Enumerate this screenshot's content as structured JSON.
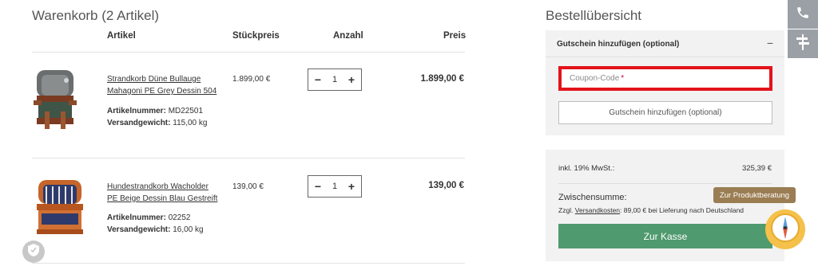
{
  "cart": {
    "title": "Warenkorb (2 Artikel)",
    "columns": {
      "artikel": "Artikel",
      "stueckpreis": "Stückpreis",
      "anzahl": "Anzahl",
      "preis": "Preis"
    },
    "items": [
      {
        "name": "Strandkorb Düne Bullauge Mahagoni PE Grey Dessin 504",
        "artikelnummer_label": "Artikelnummer:",
        "artikelnummer": "MD22501",
        "gewicht_label": "Versandgewicht:",
        "gewicht": "115,00 kg",
        "unit_price": "1.899,00 €",
        "qty": "1",
        "line_price": "1.899,00 €",
        "qty_minus": "−",
        "qty_plus": "+"
      },
      {
        "name": "Hundestrandkorb Wacholder PE Beige Dessin Blau Gestreift",
        "artikelnummer_label": "Artikelnummer:",
        "artikelnummer": "02252",
        "gewicht_label": "Versandgewicht:",
        "gewicht": "16,00 kg",
        "unit_price": "139,00 €",
        "qty": "1",
        "line_price": "139,00 €",
        "qty_minus": "−",
        "qty_plus": "+"
      }
    ]
  },
  "summary": {
    "title": "Bestellübersicht",
    "coupon": {
      "header": "Gutschein hinzufügen (optional)",
      "collapse_symbol": "−",
      "placeholder": "Coupon-Code",
      "required_mark": "*",
      "button": "Gutschein hinzufügen (optional)"
    },
    "tax_label": "inkl. 19% MwSt.:",
    "tax_value": "325,39 €",
    "subtotal_label": "Zwischensumme:",
    "shipping_prefix": "Zzgl.",
    "shipping_link": "Versandkosten",
    "shipping_suffix": ": 89,00 € bei Lieferung nach Deutschland",
    "checkout": "Zur Kasse"
  },
  "widgets": {
    "advice_tooltip": "Zur Produktberatung",
    "icons": [
      "phone-icon",
      "sign-icon",
      "compass-icon",
      "shield-icon"
    ]
  },
  "colors": {
    "accent_green": "#4f9a6e",
    "highlight_red": "#e3131b",
    "tooltip_brown": "#9b7d53",
    "compass_yellow": "#f5c14a"
  }
}
